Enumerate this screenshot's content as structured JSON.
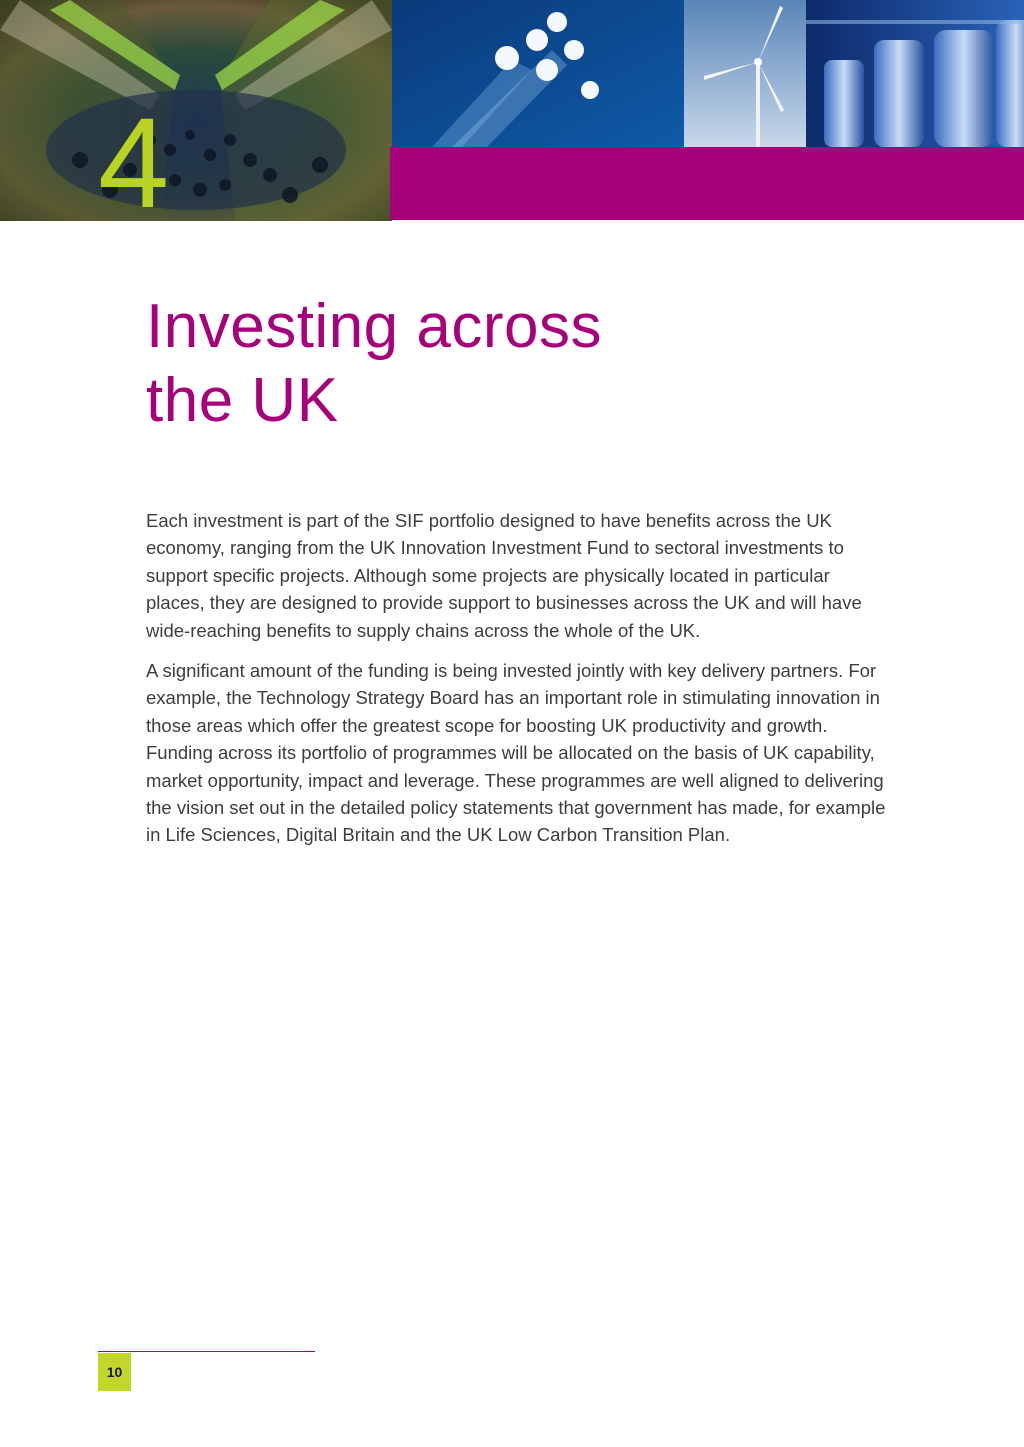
{
  "header": {
    "chapter_number": "4",
    "photos": [
      {
        "subject": "crowd-in-tunnel-photo"
      },
      {
        "subject": "light-beams-photo"
      },
      {
        "subject": "wind-turbine-photo"
      },
      {
        "subject": "industrial-tanks-photo"
      }
    ],
    "band_color": "#a6007a"
  },
  "title": {
    "line1": "Investing across",
    "line2": "the UK"
  },
  "body": {
    "paragraph1": "Each investment is part of the SIF portfolio designed to have benefits across the UK economy, ranging from the UK Innovation Investment Fund to sectoral investments to support specific projects. Although some projects are physically located in particular places, they are designed to provide support to businesses across the UK and will have wide-reaching benefits to supply chains across the whole of the UK.",
    "paragraph2": "A significant amount of the funding is being invested jointly with key delivery partners. For example, the Technology Strategy Board has an important role in stimulating innovation in those areas which offer the greatest scope for boosting UK productivity and growth. Funding across its portfolio of programmes will be allocated on the basis of UK capability, market opportunity, impact and leverage. These programmes are well aligned to delivering the vision set out in the detailed policy statements that government has made, for example in Life Sciences, Digital Britain and the UK Low Carbon Transition Plan."
  },
  "footer": {
    "page_number": "10",
    "accent_color": "#c3d62a"
  }
}
